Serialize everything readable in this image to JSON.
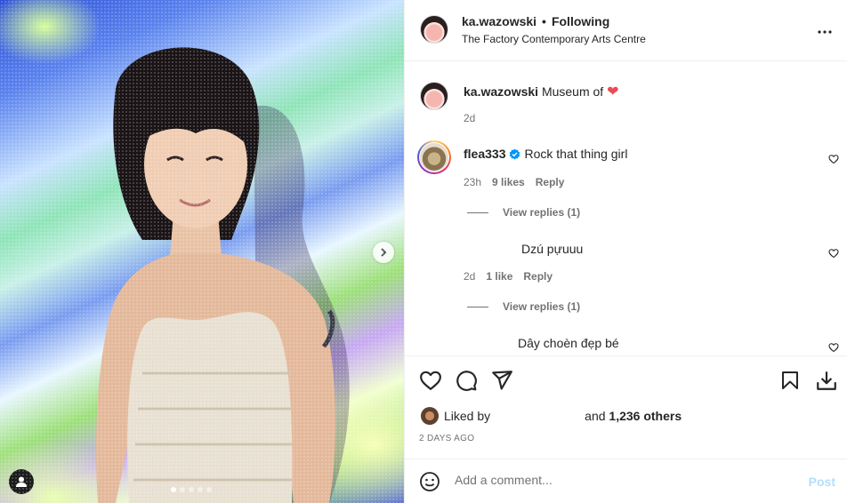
{
  "post": {
    "username": "ka.wazowski",
    "separator": "•",
    "follow_status": "Following",
    "location": "The Factory Contemporary Arts Centre",
    "more_icon": "more-horizontal-icon"
  },
  "caption": {
    "username": "ka.wazowski",
    "text": "Museum of",
    "emoji": "❤",
    "age": "2d"
  },
  "comments": [
    {
      "username": "flea333",
      "verified": true,
      "text": "Rock that thing girl",
      "age": "23h",
      "likes": "9 likes",
      "reply": "Reply",
      "view_replies": "View replies (1)"
    },
    {
      "username": "",
      "text": "Dzú pựuuu",
      "age": "2d",
      "likes": "1 like",
      "reply": "Reply",
      "view_replies": "View replies (1)"
    },
    {
      "username": "",
      "text": "Dây choèn đẹp bé"
    }
  ],
  "likes": {
    "prefix": "Liked by",
    "and": "and",
    "count": "1,236 others"
  },
  "date": "2 DAYS AGO",
  "add_comment": {
    "placeholder": "Add a comment...",
    "post_label": "Post"
  },
  "colors": {
    "heart": "#ed4956",
    "verified": "#0095f6",
    "post_disabled": "#b2dffc",
    "muted": "#737373"
  }
}
